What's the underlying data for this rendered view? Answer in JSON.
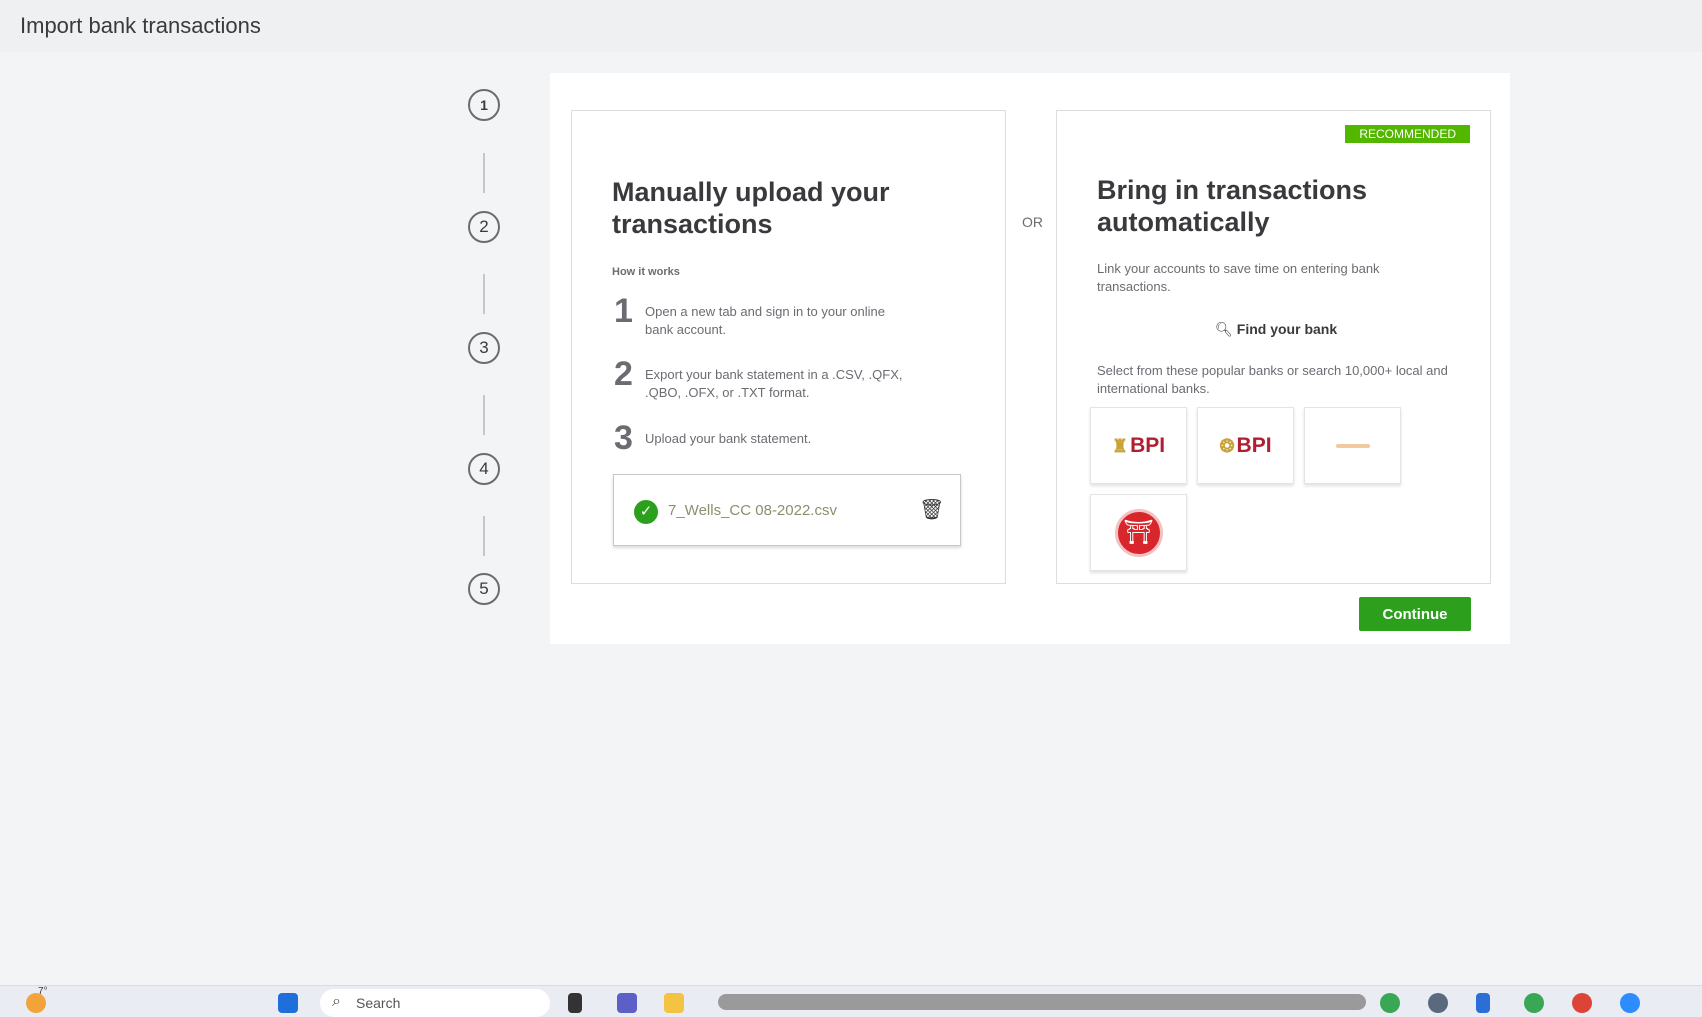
{
  "header": {
    "title": "Import bank transactions"
  },
  "steps": [
    "1",
    "2",
    "3",
    "4",
    "5"
  ],
  "manual": {
    "title": "Manually upload your transactions",
    "how": "How it works",
    "steps": [
      {
        "n": "1",
        "text": "Open a new tab and sign in to your online bank account."
      },
      {
        "n": "2",
        "text": "Export your bank statement in a .CSV, .QFX, .QBO, .OFX, or .TXT format."
      },
      {
        "n": "3",
        "text": "Upload your bank statement."
      }
    ],
    "file": "7_Wells_CC 08-2022.csv"
  },
  "or": "OR",
  "auto": {
    "badge": "RECOMMENDED",
    "title": "Bring in transactions automatically",
    "desc": "Link your accounts to save time on entering bank transactions.",
    "find": "Find your bank",
    "select": "Select from these popular banks or search 10,000+ local and international banks.",
    "banks": [
      "BPI",
      "BPI"
    ]
  },
  "continue": "Continue",
  "taskbar": {
    "weather": "7°",
    "search": "Search"
  },
  "colors": {
    "accent": "#2ca01c",
    "badge": "#53b700"
  }
}
